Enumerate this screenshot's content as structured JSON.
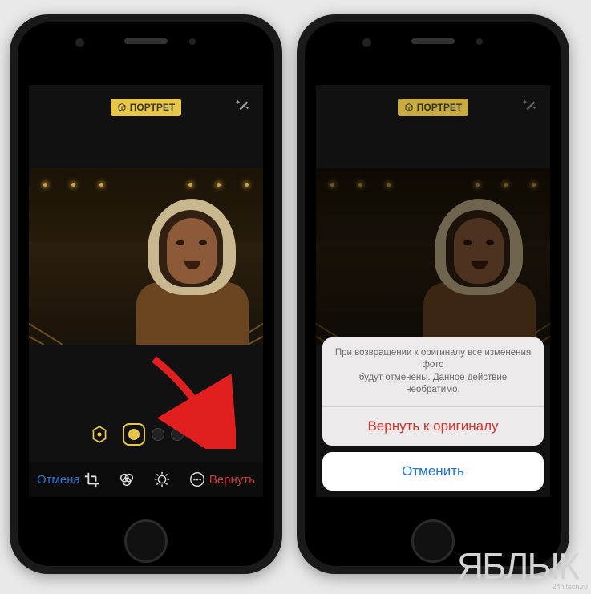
{
  "badge": {
    "label": "ПОРТРЕТ"
  },
  "left": {
    "cancel": "Отмена",
    "revert": "Вернуть"
  },
  "sheet": {
    "message_l1": "При возвращении к оригиналу все изменения фото",
    "message_l2": "будут отменены. Данное действие необратимо.",
    "revert": "Вернуть к оригиналу",
    "cancel": "Отменить"
  },
  "watermark": {
    "text": "ЯБЛЫК",
    "corner": "24hitech.ru"
  }
}
